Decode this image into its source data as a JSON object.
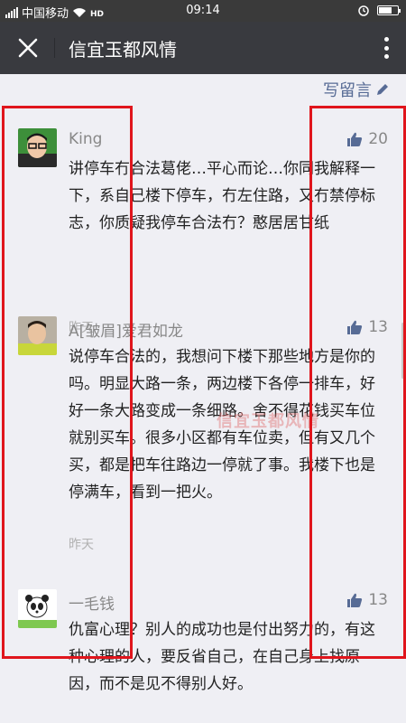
{
  "status_bar": {
    "carrier": "中国移动",
    "time": "09:14"
  },
  "header": {
    "title": "信宜玉都风情"
  },
  "write_comment": {
    "label": "写留言"
  },
  "comments": [
    {
      "name": "King",
      "likes": "20",
      "text": "讲停车冇合法葛佬…平心而论…你同我解释一下，系自己楼下停车，冇左住路，又冇禁停标志，你质疑我停车合法冇？憨居居甘纸",
      "time": "昨天"
    },
    {
      "name": "A[皱眉]爱君如龙",
      "likes": "13",
      "text": "说停车合法的，我想问下楼下那些地方是你的吗。明显大路一条，两边楼下各停一排车，好好一条大路变成一条细路。舍不得花钱买车位就别买车。很多小区都有车位卖，但有又几个买，都是把车往路边一停就了事。我楼下也是停满车，看到一把火。",
      "time": "昨天"
    },
    {
      "name": "一毛钱",
      "likes": "13",
      "text": "仇富心理？别人的成功也是付出努力的，有这种心理的人，要反省自己，在自己身上找原因，而不是见不得别人好。",
      "time": ""
    }
  ],
  "watermark": {
    "text": "信宜玉都风情"
  },
  "colors": {
    "link": "#576b95",
    "highlight_box": "#e0151c",
    "header_bg": "#393a3f"
  }
}
